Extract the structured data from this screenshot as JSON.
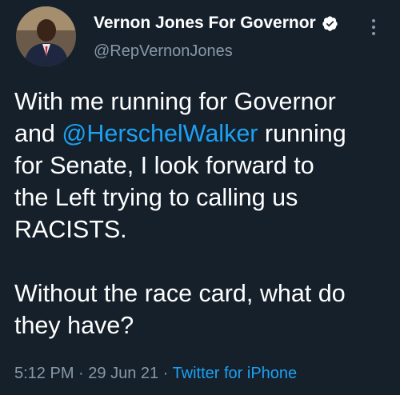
{
  "author": {
    "display_name": "Vernon Jones For Governor",
    "handle": "@RepVernonJones",
    "verified_icon": "verified-badge-icon",
    "avatar_icon": "profile-photo"
  },
  "menu": {
    "icon": "more-vertical-icon"
  },
  "tweet": {
    "line1": "With me running for Governor",
    "line2_pre": "and ",
    "mention": "@HerschelWalker",
    "line2_post": " running",
    "line3": "for Senate, I look forward to",
    "line4": "the Left trying to calling us",
    "line5": "RACISTS.",
    "line6": "Without the race card, what do",
    "line7": "they have?"
  },
  "meta": {
    "time": "5:12 PM",
    "separator1": " · ",
    "date": "29 Jun 21",
    "separator2": " · ",
    "source": "Twitter for iPhone"
  },
  "colors": {
    "background": "#15202b",
    "text": "#ffffff",
    "secondary_text": "#8899a6",
    "link": "#1da1f2"
  }
}
